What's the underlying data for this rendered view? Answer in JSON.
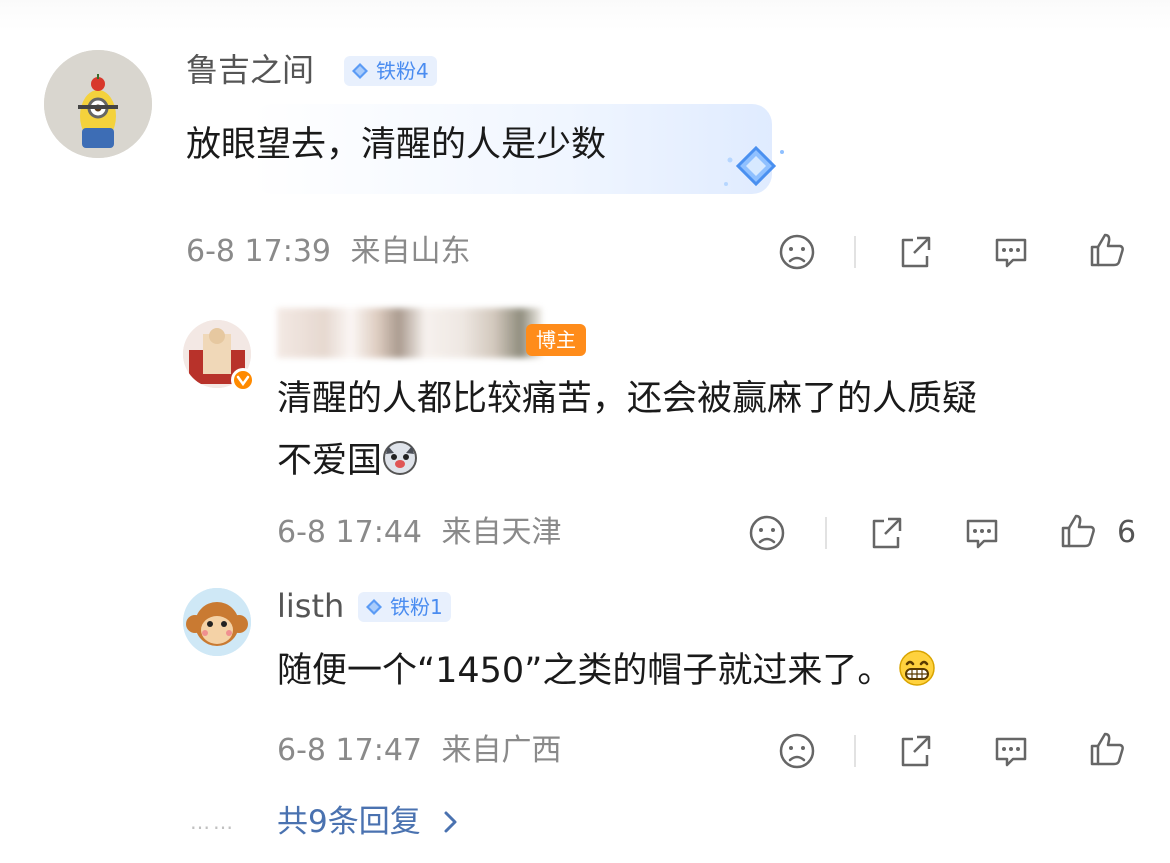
{
  "comments": [
    {
      "username": "鲁吉之间",
      "fan_badge": "铁粉4",
      "text": "放眼望去，清醒的人是少数",
      "time": "6-8 17:39",
      "location": "来自山东",
      "avatar": "minion-avatar"
    },
    {
      "username_blurred": true,
      "role_badge": "博主",
      "text_line1": "清醒的人都比较痛苦，还会被赢麻了的人质疑",
      "text_line2": "不爱国",
      "emoji": "husky-emoji",
      "time": "6-8 17:44",
      "location": "来自天津",
      "like_count": "6",
      "avatar": "blogger-avatar"
    },
    {
      "username": "listh",
      "fan_badge": "铁粉1",
      "text": "随便一个“1450”之类的帽子就过来了。",
      "emoji": "grin-emoji",
      "time": "6-8 17:47",
      "location": "来自广西",
      "avatar": "monkey-avatar"
    }
  ],
  "replies_link": "共9条回复",
  "replies_dots": "……",
  "icons": [
    "dislike-icon",
    "share-icon",
    "comment-icon",
    "like-icon"
  ],
  "colors": {
    "fan_badge_bg": "#e8f0fd",
    "fan_badge_text": "#4a8cf0",
    "host_badge": "#ff8c1a",
    "link": "#4a72b0",
    "meta": "#8a8a8a"
  }
}
